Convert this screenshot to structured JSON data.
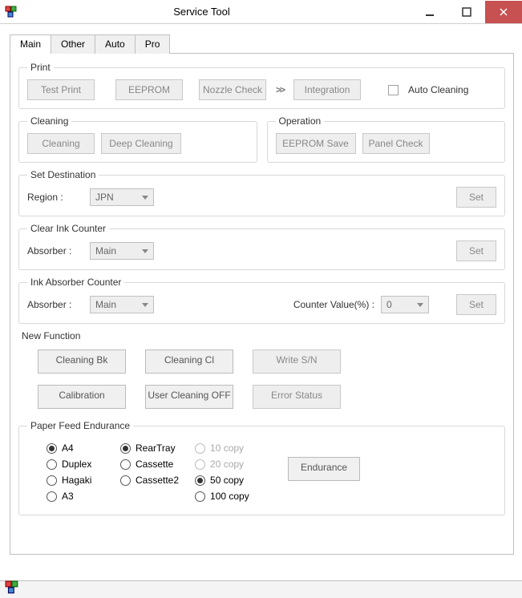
{
  "window": {
    "title": "Service Tool"
  },
  "tabs": {
    "main": "Main",
    "other": "Other",
    "auto": "Auto",
    "pro": "Pro"
  },
  "print": {
    "legend": "Print",
    "test_print": "Test Print",
    "eeprom": "EEPROM",
    "nozzle": "Nozzle Check",
    "integration": "Integration",
    "auto_clean": "Auto Cleaning"
  },
  "cleaning": {
    "legend": "Cleaning",
    "cleaning": "Cleaning",
    "deep": "Deep Cleaning"
  },
  "operation": {
    "legend": "Operation",
    "eeprom_save": "EEPROM Save",
    "panel_check": "Panel Check"
  },
  "dest": {
    "legend": "Set Destination",
    "region_lbl": "Region :",
    "region_val": "JPN",
    "set": "Set"
  },
  "clear_ink": {
    "legend": "Clear Ink Counter",
    "absorber_lbl": "Absorber :",
    "absorber_val": "Main",
    "set": "Set"
  },
  "ink_abs": {
    "legend": "Ink Absorber Counter",
    "absorber_lbl": "Absorber :",
    "absorber_val": "Main",
    "counter_lbl": "Counter Value(%) :",
    "counter_val": "0",
    "set": "Set"
  },
  "new_fn": {
    "label": "New Function",
    "cleaning_bk": "Cleaning Bk",
    "cleaning_cl": "Cleaning Cl",
    "write_sn": "Write S/N",
    "calibration": "Calibration",
    "user_clean_off": "User Cleaning OFF",
    "error_status": "Error Status"
  },
  "feed": {
    "legend": "Paper Feed Endurance",
    "a4": "A4",
    "duplex": "Duplex",
    "hagaki": "Hagaki",
    "a3": "A3",
    "rear": "RearTray",
    "cassette": "Cassette",
    "cassette2": "Cassette2",
    "c10": "10 copy",
    "c20": "20 copy",
    "c50": "50 copy",
    "c100": "100 copy",
    "endurance": "Endurance"
  }
}
